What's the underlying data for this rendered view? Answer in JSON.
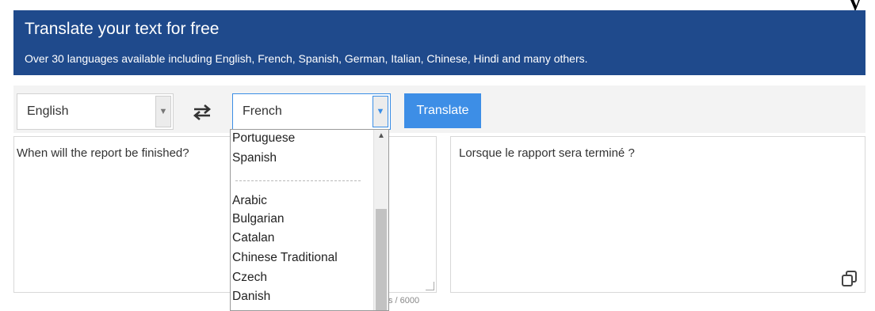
{
  "corner_glyph": "y",
  "banner": {
    "title": "Translate your text for free",
    "subtitle": "Over 30 languages available including English, French, Spanish, German, Italian, Chinese, Hindi and many others."
  },
  "controls": {
    "source_language": "English",
    "target_language": "French",
    "swap_icon": "swap-arrows-icon",
    "translate_label": "Translate"
  },
  "source": {
    "text": "When will the report be finished?",
    "char_count": "s / 6000"
  },
  "target": {
    "text": "Lorsque le rapport sera terminé ?",
    "copy_icon": "copy-icon"
  },
  "dropdown": {
    "options": [
      "Portuguese",
      "Spanish",
      "Arabic",
      "Bulgarian",
      "Catalan",
      "Chinese Traditional",
      "Czech",
      "Danish"
    ]
  },
  "colors": {
    "banner": "#1f4a8c",
    "accent": "#3d8ee6"
  }
}
